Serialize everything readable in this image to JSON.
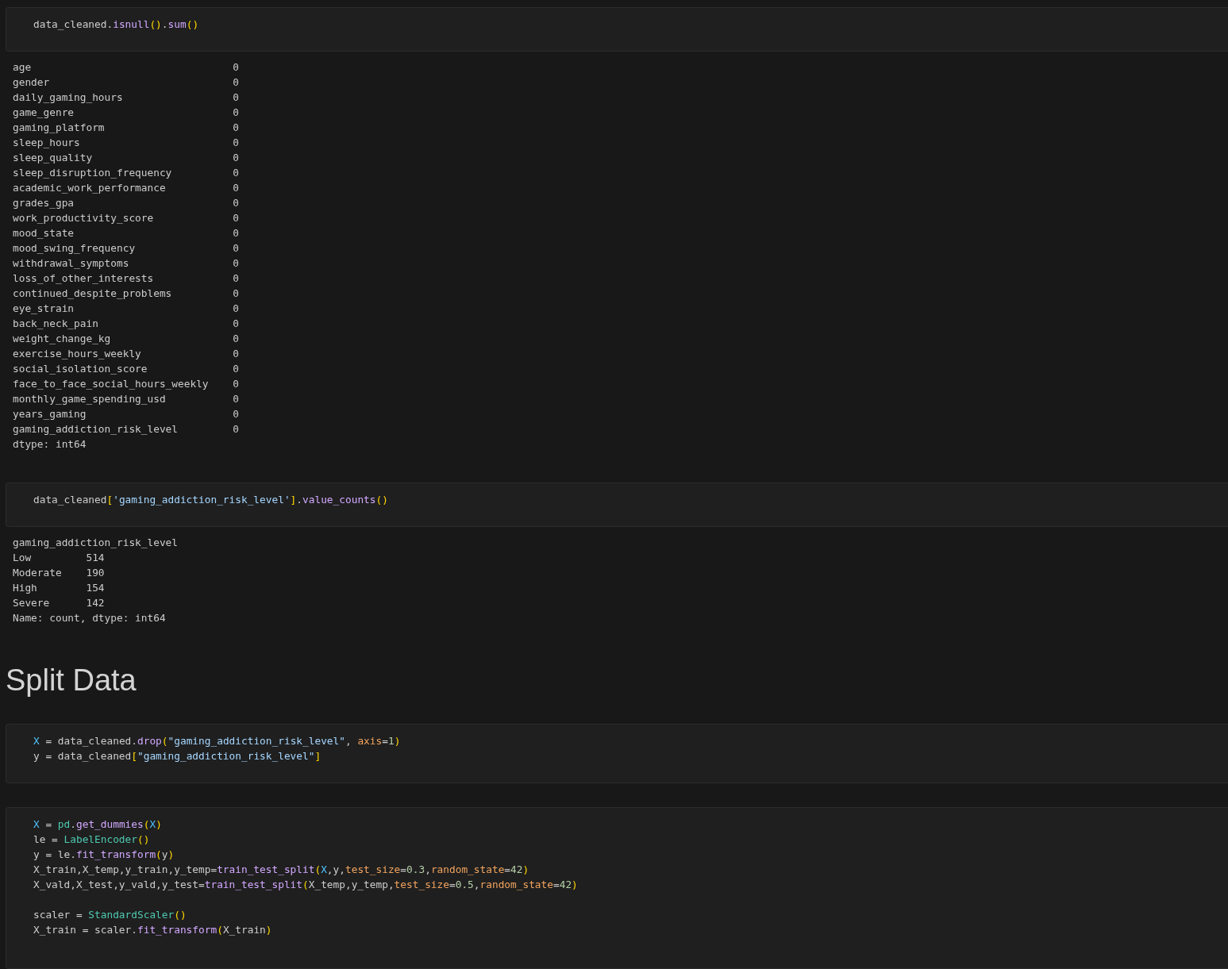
{
  "blocks": [
    {
      "kind": "code",
      "groups": [
        [
          [
            {
              "t": "data_cleaned.",
              "kind": "p"
            },
            {
              "t": "isnull",
              "kind": "f"
            },
            {
              "t": "()",
              "kind": "b"
            },
            {
              "t": ".",
              "kind": "p"
            },
            {
              "t": "sum",
              "kind": "f"
            },
            {
              "t": "()",
              "kind": "b"
            }
          ]
        ]
      ]
    },
    {
      "kind": "series",
      "rows": [
        {
          "name": "age",
          "value": "0"
        },
        {
          "name": "gender",
          "value": "0"
        },
        {
          "name": "daily_gaming_hours",
          "value": "0"
        },
        {
          "name": "game_genre",
          "value": "0"
        },
        {
          "name": "gaming_platform",
          "value": "0"
        },
        {
          "name": "sleep_hours",
          "value": "0"
        },
        {
          "name": "sleep_quality",
          "value": "0"
        },
        {
          "name": "sleep_disruption_frequency",
          "value": "0"
        },
        {
          "name": "academic_work_performance",
          "value": "0"
        },
        {
          "name": "grades_gpa",
          "value": "0"
        },
        {
          "name": "work_productivity_score",
          "value": "0"
        },
        {
          "name": "mood_state",
          "value": "0"
        },
        {
          "name": "mood_swing_frequency",
          "value": "0"
        },
        {
          "name": "withdrawal_symptoms",
          "value": "0"
        },
        {
          "name": "loss_of_other_interests",
          "value": "0"
        },
        {
          "name": "continued_despite_problems",
          "value": "0"
        },
        {
          "name": "eye_strain",
          "value": "0"
        },
        {
          "name": "back_neck_pain",
          "value": "0"
        },
        {
          "name": "weight_change_kg",
          "value": "0"
        },
        {
          "name": "exercise_hours_weekly",
          "value": "0"
        },
        {
          "name": "social_isolation_score",
          "value": "0"
        },
        {
          "name": "face_to_face_social_hours_weekly",
          "value": "0"
        },
        {
          "name": "monthly_game_spending_usd",
          "value": "0"
        },
        {
          "name": "years_gaming",
          "value": "0"
        },
        {
          "name": "gaming_addiction_risk_level",
          "value": "0"
        }
      ],
      "footer": "dtype: int64"
    },
    {
      "kind": "code",
      "groups": [
        [
          [
            {
              "t": "data_cleaned",
              "kind": "p"
            },
            {
              "t": "[",
              "kind": "b"
            },
            {
              "t": "'gaming_addiction_risk_level'",
              "kind": "s"
            },
            {
              "t": "]",
              "kind": "b"
            },
            {
              "t": ".",
              "kind": "p"
            },
            {
              "t": "value_counts",
              "kind": "f"
            },
            {
              "t": "()",
              "kind": "b"
            }
          ]
        ]
      ]
    },
    {
      "kind": "series",
      "header": "gaming_addiction_risk_level",
      "rows": [
        {
          "name": "Low",
          "value": "514"
        },
        {
          "name": "Moderate",
          "value": "190"
        },
        {
          "name": "High",
          "value": "154"
        },
        {
          "name": "Severe",
          "value": "142"
        }
      ],
      "footer": "Name: count, dtype: int64"
    },
    {
      "kind": "heading",
      "text": "Split Data"
    },
    {
      "kind": "code",
      "groups": [
        [
          [
            {
              "t": "X",
              "kind": "v"
            },
            {
              "t": " = data_cleaned.",
              "kind": "p"
            },
            {
              "t": "drop",
              "kind": "f"
            },
            {
              "t": "(",
              "kind": "b"
            },
            {
              "t": "\"gaming_addiction_risk_level\"",
              "kind": "s"
            },
            {
              "t": ", ",
              "kind": "p"
            },
            {
              "t": "axis",
              "kind": "a"
            },
            {
              "t": "=",
              "kind": "p"
            },
            {
              "t": "1",
              "kind": "n"
            },
            {
              "t": ")",
              "kind": "b"
            }
          ],
          [
            {
              "t": "y = data_cleaned",
              "kind": "p"
            },
            {
              "t": "[",
              "kind": "b"
            },
            {
              "t": "\"gaming_addiction_risk_level\"",
              "kind": "s"
            },
            {
              "t": "]",
              "kind": "b"
            }
          ]
        ]
      ]
    },
    {
      "kind": "code",
      "groups": [
        [
          [
            {
              "t": "X",
              "kind": "v"
            },
            {
              "t": " = ",
              "kind": "p"
            },
            {
              "t": "pd",
              "kind": "c"
            },
            {
              "t": ".",
              "kind": "p"
            },
            {
              "t": "get_dummies",
              "kind": "f"
            },
            {
              "t": "(",
              "kind": "b"
            },
            {
              "t": "X",
              "kind": "v"
            },
            {
              "t": ")",
              "kind": "b"
            }
          ],
          [
            {
              "t": "le = ",
              "kind": "p"
            },
            {
              "t": "LabelEncoder",
              "kind": "c"
            },
            {
              "t": "()",
              "kind": "b"
            }
          ],
          [
            {
              "t": "y = le.",
              "kind": "p"
            },
            {
              "t": "fit_transform",
              "kind": "f"
            },
            {
              "t": "(",
              "kind": "b"
            },
            {
              "t": "y",
              "kind": "p"
            },
            {
              "t": ")",
              "kind": "b"
            }
          ],
          [
            {
              "t": "X_train,X_temp,y_train,y_temp=",
              "kind": "p"
            },
            {
              "t": "train_test_split",
              "kind": "f"
            },
            {
              "t": "(",
              "kind": "b"
            },
            {
              "t": "X",
              "kind": "v"
            },
            {
              "t": ",y,",
              "kind": "p"
            },
            {
              "t": "test_size",
              "kind": "a"
            },
            {
              "t": "=",
              "kind": "p"
            },
            {
              "t": "0.3",
              "kind": "n"
            },
            {
              "t": ",",
              "kind": "p"
            },
            {
              "t": "random_state",
              "kind": "a"
            },
            {
              "t": "=",
              "kind": "p"
            },
            {
              "t": "42",
              "kind": "n"
            },
            {
              "t": ")",
              "kind": "b"
            }
          ],
          [
            {
              "t": "X_vald,X_test,y_vald,y_test=",
              "kind": "p"
            },
            {
              "t": "train_test_split",
              "kind": "f"
            },
            {
              "t": "(",
              "kind": "b"
            },
            {
              "t": "X_temp,y_temp,",
              "kind": "p"
            },
            {
              "t": "test_size",
              "kind": "a"
            },
            {
              "t": "=",
              "kind": "p"
            },
            {
              "t": "0.5",
              "kind": "n"
            },
            {
              "t": ",",
              "kind": "p"
            },
            {
              "t": "random_state",
              "kind": "a"
            },
            {
              "t": "=",
              "kind": "p"
            },
            {
              "t": "42",
              "kind": "n"
            },
            {
              "t": ")",
              "kind": "b"
            }
          ]
        ],
        [
          [
            {
              "t": "scaler = ",
              "kind": "p"
            },
            {
              "t": "StandardScaler",
              "kind": "c"
            },
            {
              "t": "()",
              "kind": "b"
            }
          ],
          [
            {
              "t": "X_train = scaler.",
              "kind": "p"
            },
            {
              "t": "fit_transform",
              "kind": "f"
            },
            {
              "t": "(",
              "kind": "b"
            },
            {
              "t": "X_train",
              "kind": "p"
            },
            {
              "t": ")",
              "kind": "b"
            }
          ]
        ]
      ]
    }
  ]
}
